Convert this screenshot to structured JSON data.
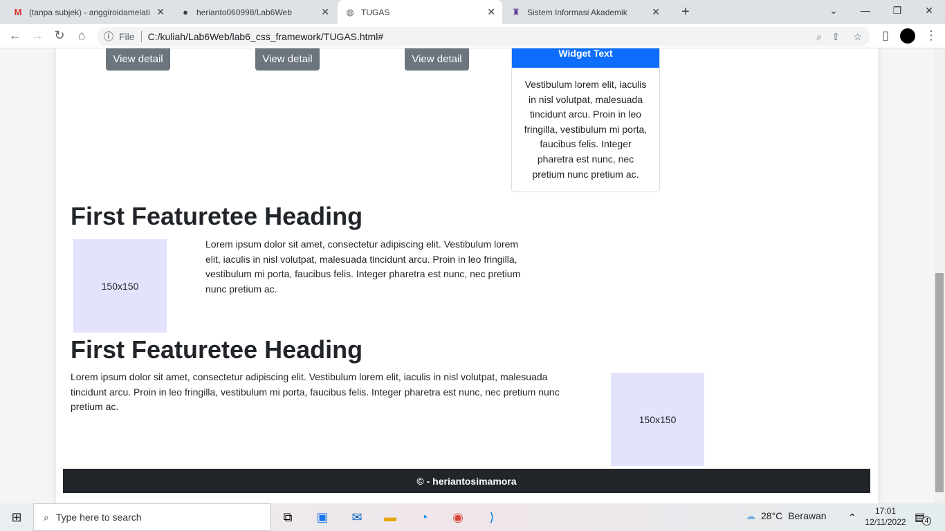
{
  "browser": {
    "tabs": [
      {
        "title": "(tanpa subjek) - anggiroidamelati",
        "icon": "gmail-icon"
      },
      {
        "title": "herianto060998/Lab6Web",
        "icon": "github-icon"
      },
      {
        "title": "TUGAS",
        "icon": "globe-icon",
        "active": true
      },
      {
        "title": "Sistem Informasi Akademik",
        "icon": "academic-icon"
      }
    ],
    "scheme": "File",
    "url": "C:/kuliah/Lab6Web/lab6_css_framework/TUGAS.html#"
  },
  "page": {
    "buttons": [
      "View detail",
      "View detail",
      "View detail"
    ],
    "widget": {
      "title": "Widget Text",
      "body": "Vestibulum lorem elit, iaculis in nisl volutpat, malesuada tincidunt arcu. Proin in leo fringilla, vestibulum mi porta, faucibus felis. Integer pharetra est nunc, nec pretium nunc pretium ac."
    },
    "featurettes": [
      {
        "heading": "First Featuretee Heading",
        "image": "150x150",
        "text": "Lorem ipsum dolor sit amet, consectetur adipiscing elit. Vestibulum lorem elit, iaculis in nisl volutpat, malesuada tincidunt arcu. Proin in leo fringilla, vestibulum mi porta, faucibus felis. Integer pharetra est nunc, nec pretium nunc pretium ac."
      },
      {
        "heading": "First Featuretee Heading",
        "image": "150x150",
        "text": "Lorem ipsum dolor sit amet, consectetur adipiscing elit. Vestibulum lorem elit, iaculis in nisl volutpat, malesuada tincidunt arcu. Proin in leo fringilla, vestibulum mi porta, faucibus felis. Integer pharetra est nunc, nec pretium nunc pretium ac."
      }
    ],
    "footer": "© - heriantosimamora"
  },
  "taskbar": {
    "search_placeholder": "Type here to search",
    "temperature": "28°C",
    "weather": "Berawan",
    "time": "17:01",
    "date": "12/11/2022",
    "notifications": "4"
  },
  "colors": {
    "primary": "#0d6efd",
    "secondary": "#6c757d",
    "footer": "#212529",
    "placeholder": "#e4e3fd"
  }
}
